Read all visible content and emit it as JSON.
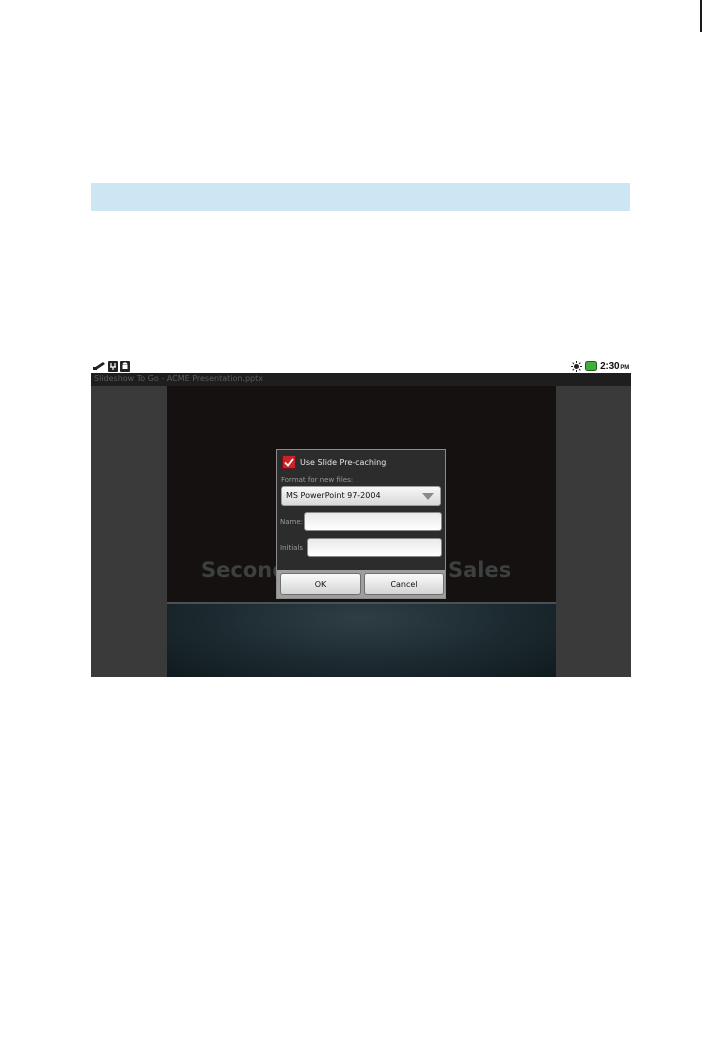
{
  "statusbar": {
    "icons_left": [
      "usb-icon",
      "debug-icon",
      "android-icon"
    ],
    "icons_right": [
      "brightness-icon",
      "battery-icon"
    ],
    "time": "2:30",
    "ampm": "PM"
  },
  "app": {
    "window_title": "Slideshow To Go - ACME Presentation.pptx"
  },
  "slide": {
    "title_left": "Second",
    "title_right": "Sales"
  },
  "dialog": {
    "precache_label": "Use Slide Pre-caching",
    "precache_checked": true,
    "format_label": "Format for new files:",
    "format_value": "MS PowerPoint 97-2004",
    "name_label": "Name:",
    "name_value": "",
    "initials_label": "Initials",
    "initials_value": "",
    "ok_label": "OK",
    "cancel_label": "Cancel"
  },
  "colors": {
    "header_band": "#cde6f3",
    "checkbox": "#c8232a",
    "battery": "#3fae3a"
  }
}
